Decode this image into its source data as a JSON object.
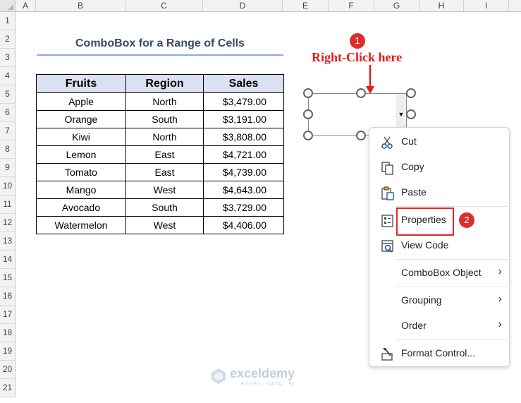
{
  "columns": [
    "A",
    "B",
    "C",
    "D",
    "E",
    "F",
    "G",
    "H",
    "I"
  ],
  "rows": [
    "1",
    "2",
    "3",
    "4",
    "5",
    "6",
    "7",
    "8",
    "9",
    "10",
    "11",
    "12",
    "13",
    "14",
    "15",
    "16",
    "17",
    "18",
    "19",
    "20",
    "21"
  ],
  "title": "ComboBox for a Range of Cells",
  "table": {
    "headers": [
      "Fruits",
      "Region",
      "Sales"
    ],
    "rows": [
      {
        "fruit": "Apple",
        "region": "North",
        "sales": "$3,479.00"
      },
      {
        "fruit": "Orange",
        "region": "South",
        "sales": "$3,191.00"
      },
      {
        "fruit": "Kiwi",
        "region": "North",
        "sales": "$3,808.00"
      },
      {
        "fruit": "Lemon",
        "region": "East",
        "sales": "$4,721.00"
      },
      {
        "fruit": "Tomato",
        "region": "East",
        "sales": "$4,739.00"
      },
      {
        "fruit": "Mango",
        "region": "West",
        "sales": "$4,643.00"
      },
      {
        "fruit": "Avocado",
        "region": "South",
        "sales": "$3,729.00"
      },
      {
        "fruit": "Watermelon",
        "region": "West",
        "sales": "$4,406.00"
      }
    ]
  },
  "callout": {
    "text": "Right-Click here",
    "step1": "1",
    "step2": "2"
  },
  "menu": {
    "cut": "Cut",
    "copy": "Copy",
    "paste": "Paste",
    "properties": "Properties",
    "view_code": "View Code",
    "combobox_object": "ComboBox Object",
    "grouping": "Grouping",
    "order": "Order",
    "format_control": "Format Control...",
    "submenu_arrow": "›"
  },
  "combo": {
    "dropdown_glyph": "▼"
  },
  "watermark": {
    "brand": "exceldemy",
    "tagline": "EXCEL · DATA · BI"
  },
  "colors": {
    "accent_red": "#e31b1b",
    "header_fill": "#d9e1f2",
    "title_text": "#3b4a5e"
  }
}
